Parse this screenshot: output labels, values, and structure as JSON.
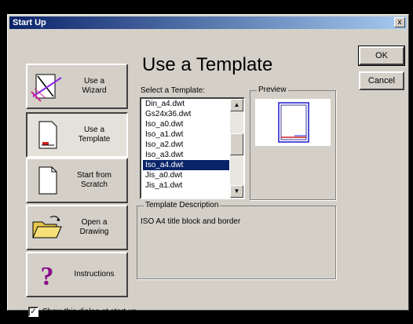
{
  "window": {
    "title": "Start Up",
    "close_glyph": "x"
  },
  "modes": [
    {
      "label": "Use a\nWizard",
      "icon": "wizard-icon",
      "pressed": false
    },
    {
      "label": "Use a\nTemplate",
      "icon": "template-page-icon",
      "pressed": true
    },
    {
      "label": "Start from\nScratch",
      "icon": "blank-page-icon",
      "pressed": false
    },
    {
      "label": "Open a\nDrawing",
      "icon": "open-folder-icon",
      "pressed": false
    },
    {
      "label": "Instructions",
      "icon": "question-mark-icon",
      "pressed": false
    }
  ],
  "main": {
    "heading": "Use a Template",
    "select_label": "Select a Template:",
    "templates": [
      "Din_a4.dwt",
      "Gs24x36.dwt",
      "Iso_a0.dwt",
      "Iso_a1.dwt",
      "Iso_a2.dwt",
      "Iso_a3.dwt",
      "Iso_a4.dwt",
      "Jis_a0.dwt",
      "Jis_a1.dwt"
    ],
    "selected_template": "Iso_a4.dwt",
    "preview_label": "Preview",
    "description_label": "Template Description",
    "description_text": "ISO A4 title block and border"
  },
  "buttons": {
    "ok": "OK",
    "cancel": "Cancel"
  },
  "footer": {
    "show_dialog_label": "Show this dialog at start up",
    "show_dialog_checked": true
  },
  "colors": {
    "selection": "#0a246a",
    "title_bar": "#0a246a",
    "preview_border": "#1a1acc"
  }
}
